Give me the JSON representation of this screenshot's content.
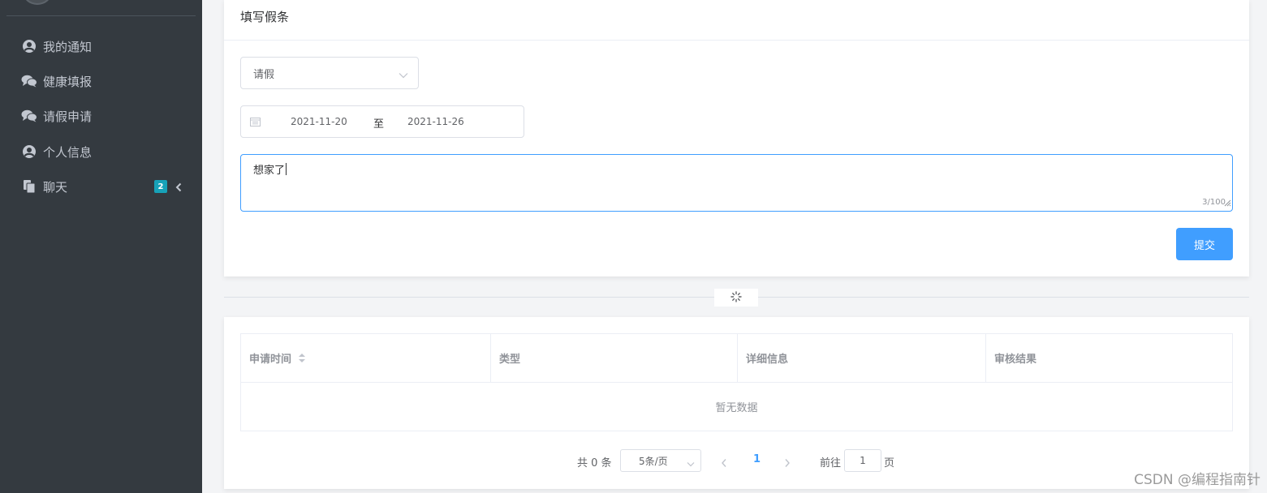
{
  "sidebar": {
    "items": [
      {
        "label": "我的通知",
        "icon": "user-circle-icon"
      },
      {
        "label": "健康填报",
        "icon": "comments-icon"
      },
      {
        "label": "请假申请",
        "icon": "comments-icon"
      },
      {
        "label": "个人信息",
        "icon": "user-circle-icon"
      },
      {
        "label": "聊天",
        "icon": "copy-icon",
        "badge": "2"
      }
    ]
  },
  "form": {
    "title": "填写假条",
    "type_select": {
      "value": "请假"
    },
    "date_range": {
      "start": "2021-11-20",
      "separator": "至",
      "end": "2021-11-26"
    },
    "reason": {
      "value": "想家了",
      "counter": "3/100"
    },
    "submit_label": "提交"
  },
  "table": {
    "columns": [
      "申请时间",
      "类型",
      "详细信息",
      "审核结果"
    ],
    "empty_text": "暂无数据"
  },
  "pagination": {
    "total": "共 0 条",
    "page_size": "5条/页",
    "current_page": "1",
    "goto_label": "前往",
    "goto_value": "1",
    "page_suffix": "页"
  },
  "watermark": "CSDN @编程指南针",
  "colors": {
    "primary": "#409eff",
    "sidebar_bg": "#343a40",
    "badge": "#17a2b8"
  }
}
